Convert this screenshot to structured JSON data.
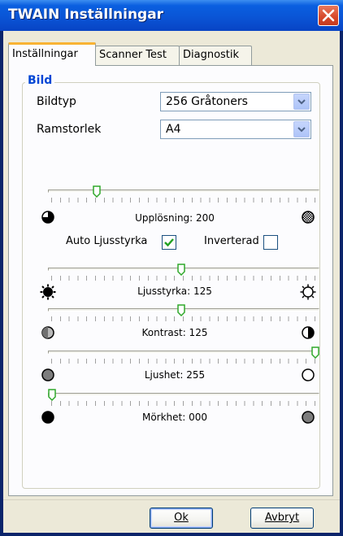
{
  "window": {
    "title": "TWAIN Inställningar",
    "close_icon": "close-icon"
  },
  "tabs": [
    {
      "label": "Inställningar",
      "active": true
    },
    {
      "label": "Scanner Test",
      "active": false
    },
    {
      "label": "Diagnostik",
      "active": false
    }
  ],
  "group": {
    "title": "Bild"
  },
  "fields": {
    "bildtyp": {
      "label": "Bildtyp",
      "value": "256 Gråtoners"
    },
    "ramstorlek": {
      "label": "Ramstorlek",
      "value": "A4"
    }
  },
  "sliders": [
    {
      "key": "resolution",
      "caption": "Upplösning: 200",
      "level": 0.17,
      "left_icon": "low-resolution-icon",
      "right_icon": "high-resolution-icon"
    },
    {
      "key": "brightness",
      "caption": "Ljusstyrka: 125",
      "level": 0.49,
      "left_icon": "dark-sun-icon",
      "right_icon": "light-sun-icon"
    },
    {
      "key": "contrast",
      "caption": "Kontrast: 125",
      "level": 0.49,
      "left_icon": "low-contrast-icon",
      "right_icon": "high-contrast-icon"
    },
    {
      "key": "highlight",
      "caption": "Ljushet: 255",
      "level": 1.0,
      "left_icon": "gray-circle-icon",
      "right_icon": "white-circle-icon"
    },
    {
      "key": "shadow",
      "caption": "Mörkhet: 000",
      "level": 0.0,
      "left_icon": "black-circle-icon",
      "right_icon": "gray-circle-icon"
    }
  ],
  "checkboxes": {
    "auto_brightness": {
      "label": "Auto Ljusstyrka",
      "checked": true
    },
    "inverted": {
      "label": "Inverterad",
      "checked": false
    }
  },
  "buttons": {
    "ok": {
      "label": "Ok"
    },
    "cancel": {
      "label": "Avbryt"
    }
  },
  "colors": {
    "title_bar": "#0a55d6",
    "group_title": "#0046d5",
    "tab_highlight": "#f8b334",
    "thumb": "#2fa82a"
  }
}
